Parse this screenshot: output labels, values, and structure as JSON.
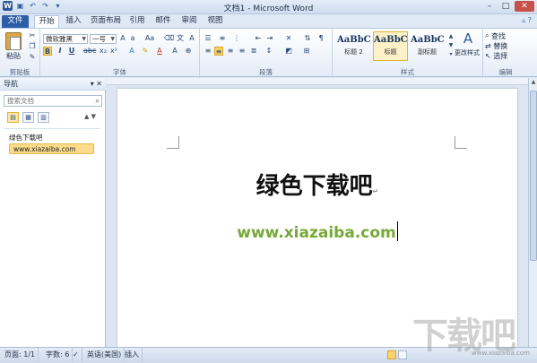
{
  "window": {
    "title": "文档1 - Microsoft Word",
    "controls": [
      "–",
      "□",
      "✕"
    ]
  },
  "tabs": [
    "文件",
    "开始",
    "插入",
    "页面布局",
    "引用",
    "邮件",
    "审阅",
    "视图"
  ],
  "ribbon": {
    "clipboard": {
      "paste_label": "粘贴",
      "group_label": "剪贴板"
    },
    "font": {
      "font_name": "微软雅黑",
      "font_size": "一号",
      "bold": "B",
      "italic": "I",
      "underline": "U",
      "strike": "abc",
      "subscript": "x₂",
      "superscript": "x²",
      "group_label": "字体"
    },
    "paragraph": {
      "group_label": "段落"
    },
    "styles": {
      "items": [
        {
          "sample": "AaBbC",
          "name": "标题 2"
        },
        {
          "sample": "AaBbC",
          "name": "标题"
        },
        {
          "sample": "AaBbC",
          "name": "副标题"
        }
      ],
      "change_styles": "更改样式",
      "group_label": "样式"
    },
    "editing": {
      "find": "查找",
      "replace": "替换",
      "select": "选择",
      "group_label": "编辑"
    }
  },
  "nav": {
    "title": "导航",
    "search_placeholder": "搜索文档",
    "outline": [
      "绿色下载吧",
      "www.xiazaiba.com"
    ]
  },
  "document": {
    "heading": "绿色下载吧",
    "url": "www.xiazaiba.com"
  },
  "status": {
    "page": "页面: 1/1",
    "words": "字数: 6",
    "language": "英语(美国)",
    "mode": "插入"
  },
  "watermark": {
    "main": "下载吧",
    "sub": "www.xiazaiba.com"
  }
}
